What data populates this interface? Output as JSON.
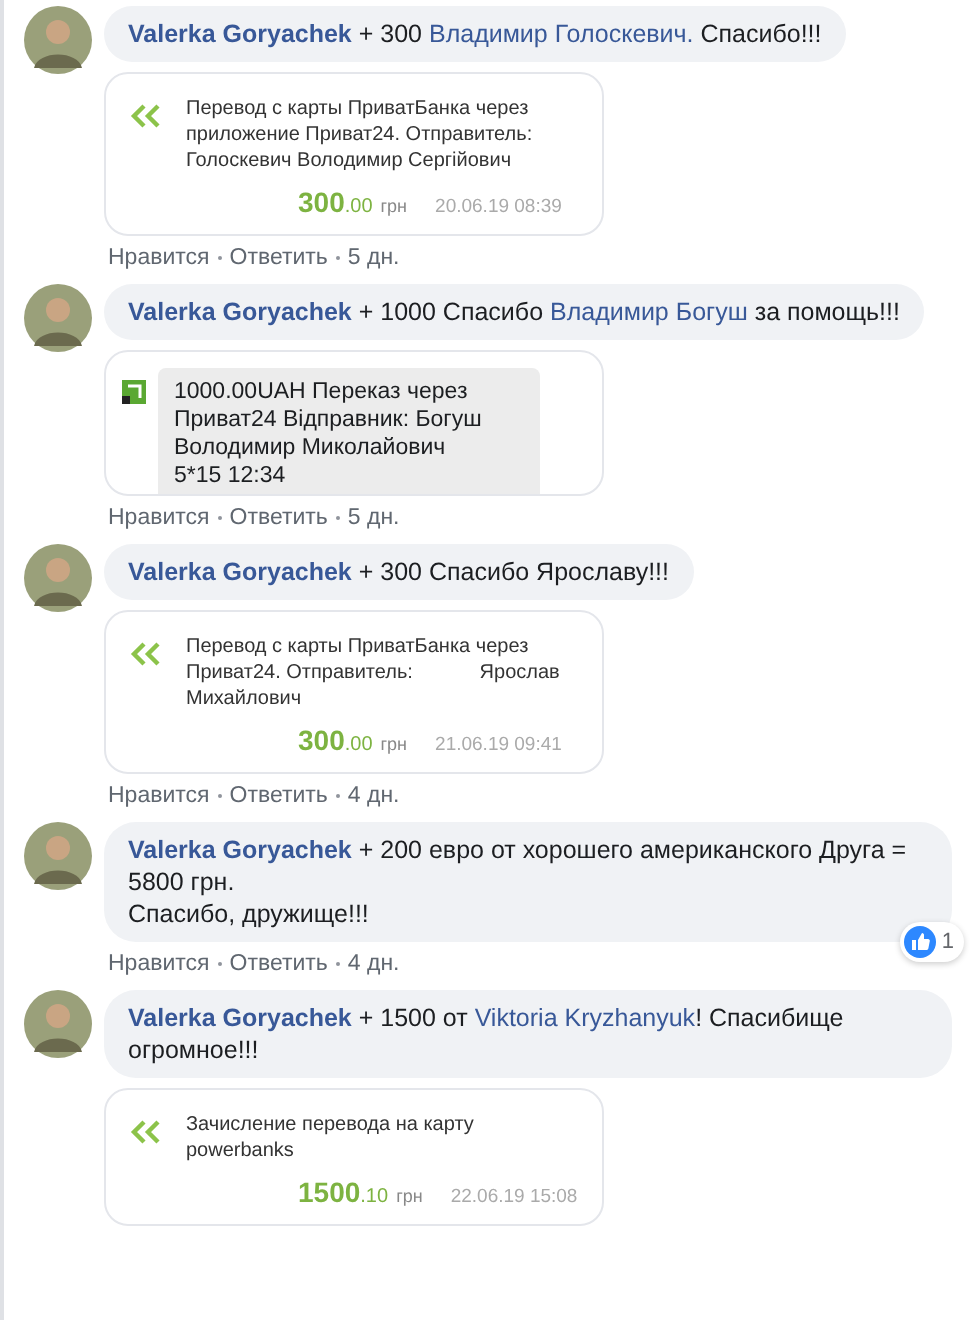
{
  "comments": [
    {
      "author": "Valerka Goryachek",
      "text": [
        {
          "text": "+ 300 ",
          "link": false
        },
        {
          "text": "Владимир Голоскевич.",
          "link": true
        },
        {
          "text": " Спасибо!!!",
          "link": false
        }
      ],
      "attachment": {
        "kind": "receipt",
        "description": "Перевод с карты ПриватБанка через приложение Приват24. Отправитель: Голоскевич Володимир Сергійович",
        "amount": "300",
        "cents": ".00",
        "currency": "грн",
        "date": "20.06.19 08:39"
      },
      "actions": [
        "Нравится",
        "Ответить",
        "5 дн."
      ]
    },
    {
      "author": "Valerka Goryachek",
      "text": [
        {
          "text": "+ 1000 Спасибо ",
          "link": false
        },
        {
          "text": "Владимир Богуш",
          "link": true
        },
        {
          "text": " за помощь!!!",
          "link": false
        }
      ],
      "attachment": {
        "kind": "sms",
        "lines": [
          "1000.00UAH Переказ через",
          "Приват24 Відправник: Богуш",
          "Володимир Миколайович",
          "5*15 12:34"
        ]
      },
      "actions": [
        "Нравится",
        "Ответить",
        "5 дн."
      ]
    },
    {
      "author": "Valerka Goryachek",
      "text": [
        {
          "text": "+ 300 Спасибо Ярославу!!!",
          "link": false
        }
      ],
      "attachment": {
        "kind": "receipt",
        "description": "Перевод с карты ПриватБанка через Приват24. Отправитель:            Ярослав Михайлович",
        "amount": "300",
        "cents": ".00",
        "currency": "грн",
        "date": "21.06.19 09:41"
      },
      "actions": [
        "Нравится",
        "Ответить",
        "4 дн."
      ]
    },
    {
      "author": "Valerka Goryachek",
      "text": [
        {
          "text": "+ 200 евро от хорошего американского Друга = 5800 грн.\nСпасибо, дружище!!!",
          "link": false
        }
      ],
      "reactions": "1",
      "actions": [
        "Нравится",
        "Ответить",
        "4 дн."
      ]
    },
    {
      "author": "Valerka Goryachek",
      "text": [
        {
          "text": "+ 1500 от ",
          "link": false
        },
        {
          "text": "Viktoria Kryzhanyuk",
          "link": true
        },
        {
          "text": "! Спасибище огромное!!!",
          "link": false
        }
      ],
      "attachment": {
        "kind": "receipt",
        "description": "Зачисление перевода на карту powerbanks",
        "amount": "1500",
        "cents": ".10",
        "currency": "грн",
        "date": "22.06.19 15:08"
      }
    }
  ]
}
